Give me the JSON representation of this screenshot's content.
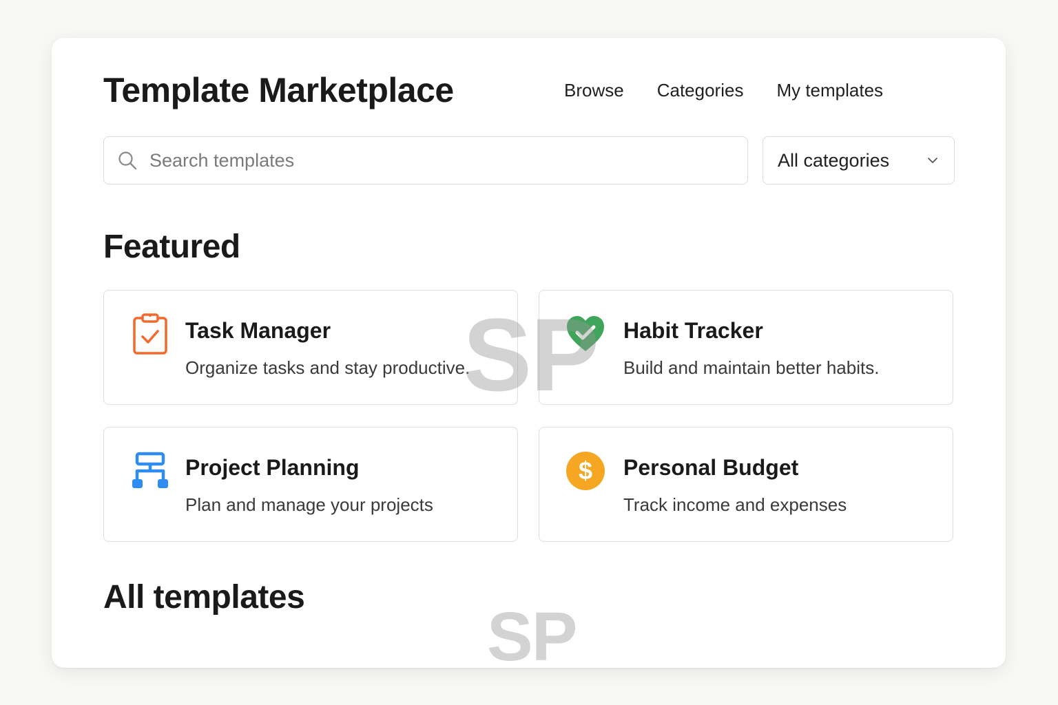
{
  "header": {
    "title": "Template Marketplace",
    "nav": [
      {
        "label": "Browse"
      },
      {
        "label": "Categories"
      },
      {
        "label": "My templates"
      }
    ]
  },
  "search": {
    "placeholder": "Search templates",
    "value": "",
    "icon": "search-icon"
  },
  "category_filter": {
    "selected": "All categories",
    "icon": "chevron-down-icon"
  },
  "featured": {
    "heading": "Featured",
    "cards": [
      {
        "title": "Task Manager",
        "description": "Organize tasks and stay productive.",
        "icon": "clipboard-check-icon",
        "color": "#f2692b"
      },
      {
        "title": "Habit Tracker",
        "description": "Build and maintain better habits.",
        "icon": "heart-check-icon",
        "color": "#3fa55b"
      },
      {
        "title": "Project Planning",
        "description": "Plan and manage your projects",
        "icon": "flowchart-icon",
        "color": "#2f8cf0"
      },
      {
        "title": "Personal Budget",
        "description": "Track income and expenses",
        "icon": "dollar-coin-icon",
        "color": "#f5a623"
      }
    ]
  },
  "all_templates": {
    "heading": "All templates"
  },
  "watermark": {
    "text": "SP"
  }
}
